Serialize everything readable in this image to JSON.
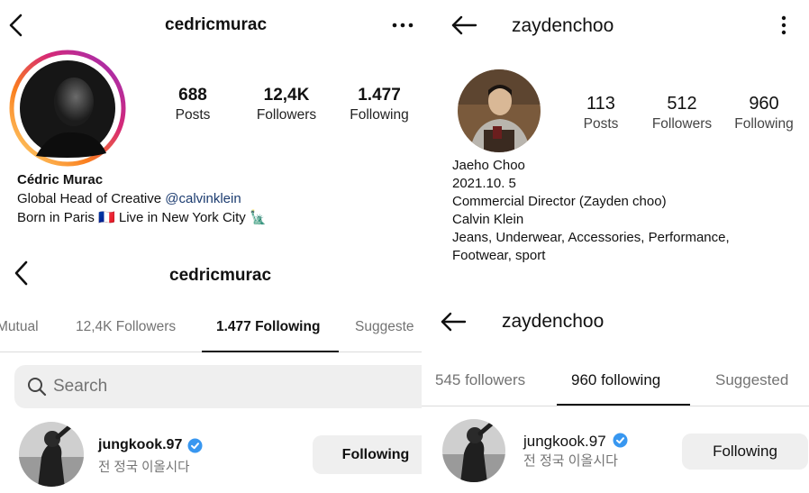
{
  "panel_tl": {
    "username": "cedricmurac",
    "stats": [
      {
        "value": "688",
        "label": "Posts"
      },
      {
        "value": "12,4K",
        "label": "Followers"
      },
      {
        "value": "1.477",
        "label": "Following"
      }
    ],
    "name": "Cédric Murac",
    "bio_line1_prefix": "Global Head of Creative ",
    "bio_mention": "@calvinklein",
    "bio_line2": "Born in Paris 🇫🇷  Live in New York City 🗽"
  },
  "panel_tr": {
    "username": "zaydenchoo",
    "stats": [
      {
        "value": "113",
        "label": "Posts"
      },
      {
        "value": "512",
        "label": "Followers"
      },
      {
        "value": "960",
        "label": "Following"
      }
    ],
    "bio_lines": [
      "Jaeho Choo",
      "2021.10. 5",
      "Commercial Director (Zayden choo)",
      "Calvin Klein",
      "Jeans, Underwear, Accessories, Performance,",
      "Footwear, sport"
    ]
  },
  "panel_bl": {
    "username": "cedricmurac",
    "tabs": [
      "Mutual",
      "12,4K Followers",
      "1.477 Following",
      "Suggeste"
    ],
    "active_tab": 2,
    "search_placeholder": "Search",
    "user": {
      "handle": "jungkook.97",
      "subtitle": "전 정국 이올시다",
      "button": "Following"
    }
  },
  "panel_br": {
    "username": "zaydenchoo",
    "tabs": [
      "545 followers",
      "960 following",
      "Suggested"
    ],
    "active_tab": 1,
    "user": {
      "handle": "jungkook.97",
      "subtitle": "전 정국 이올시다",
      "button": "Following"
    }
  },
  "colors": {
    "verified": "#3897f0",
    "button_bg": "#efefef",
    "muted_text": "#737373",
    "mention": "#1b3b6f"
  },
  "icons": [
    "back-chevron-icon",
    "back-arrow-icon",
    "more-horizontal-icon",
    "more-vertical-icon",
    "search-icon",
    "verified-badge-icon"
  ]
}
